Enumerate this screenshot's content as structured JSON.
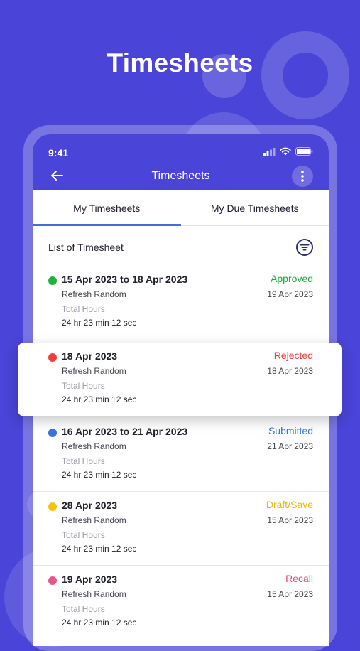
{
  "promo": {
    "title": "Timesheets"
  },
  "status_bar": {
    "time": "9:41"
  },
  "appbar": {
    "title": "Timesheets"
  },
  "tabs": [
    {
      "label": "My Timesheets",
      "active": true
    },
    {
      "label": "My Due Timesheets",
      "active": false
    }
  ],
  "list": {
    "heading": "List of Timesheet"
  },
  "timesheets": [
    {
      "range": "15 Apr 2023 to 18 Apr 2023",
      "status": "Approved",
      "status_color": "#1fa83a",
      "dot_color": "#1fb33a",
      "project": "Refresh Random",
      "date": "19 Apr 2023",
      "hours_label": "Total Hours",
      "hours": "24 hr 23 min 12 sec"
    },
    {
      "range": "18 Apr 2023",
      "status": "Rejected",
      "status_color": "#e8403e",
      "dot_color": "#e8403e",
      "project": "Refresh Random",
      "date": "18 Apr 2023",
      "hours_label": "Total Hours",
      "hours": "24 hr 23 min 12 sec"
    },
    {
      "range": "16 Apr 2023 to 21 Apr 2023",
      "status": "Submitted",
      "status_color": "#3b74d9",
      "dot_color": "#3b74d9",
      "project": "Refresh Random",
      "date": "21 Apr 2023",
      "hours_label": "Total Hours",
      "hours": "24 hr 23 min 12 sec"
    },
    {
      "range": "28 Apr 2023",
      "status": "Draft/Save",
      "status_color": "#e3b80f",
      "dot_color": "#f2c40e",
      "project": "Refresh Random",
      "date": "15 Apr 2023",
      "hours_label": "Total Hours",
      "hours": "24 hr 23 min 12 sec"
    },
    {
      "range": "19 Apr 2023",
      "status": "Recall",
      "status_color": "#e4457a",
      "dot_color": "#e8548a",
      "project": "Refresh Random",
      "date": "15 Apr 2023",
      "hours_label": "Total Hours",
      "hours": "24 hr 23 min 12 sec"
    }
  ]
}
